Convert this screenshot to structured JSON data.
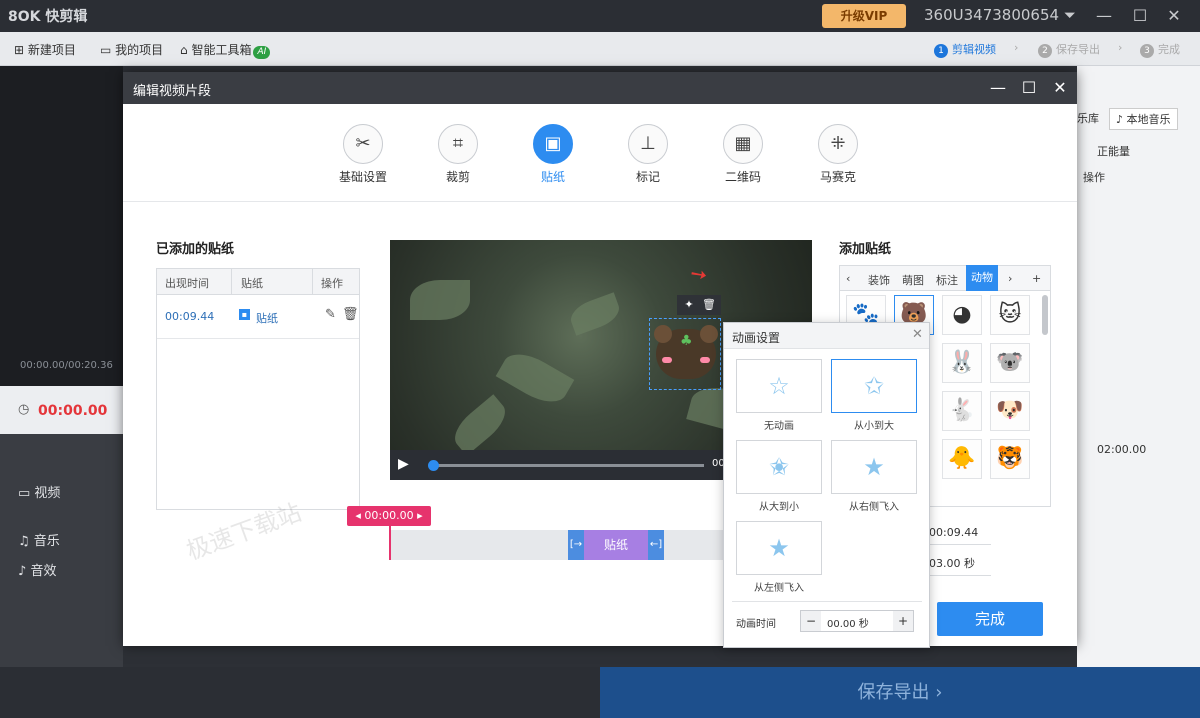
{
  "app": {
    "logo": "8OK 快剪辑",
    "vip": "升级VIP",
    "account": "360U3473800654 ⏷"
  },
  "toolbar": {
    "new_project": "新建项目",
    "my_projects": "我的项目",
    "smart_tools": "智能工具箱",
    "ai_badge": "AI",
    "steps": [
      {
        "num": "1",
        "label": "剪辑视频"
      },
      {
        "num": "2",
        "label": "保存导出"
      },
      {
        "num": "3",
        "label": "完成"
      }
    ]
  },
  "background": {
    "timecode": "00:00.00/00:20.36",
    "time": "00:00.00",
    "tracks": [
      "视频",
      "音乐",
      "音效"
    ],
    "right_music_lib": "乐库",
    "right_local_music": "本地音乐",
    "right_smart": "正能量",
    "right_ops": "操作",
    "right_time": "02:00.00",
    "export": "保存导出"
  },
  "dialog": {
    "title": "编辑视频片段",
    "tabs": [
      {
        "label": "基础设置",
        "icon": "scissors-icon"
      },
      {
        "label": "裁剪",
        "icon": "crop-icon"
      },
      {
        "label": "贴纸",
        "icon": "image-icon"
      },
      {
        "label": "标记",
        "icon": "pin-icon"
      },
      {
        "label": "二维码",
        "icon": "qrcode-icon"
      },
      {
        "label": "马赛克",
        "icon": "mosaic-icon"
      }
    ],
    "added_title": "已添加的贴纸",
    "table": {
      "headers": [
        "出现时间",
        "贴纸",
        "操作"
      ],
      "rows": [
        {
          "time": "00:09.44",
          "name": "贴纸"
        }
      ]
    },
    "video": {
      "time_short": "00"
    },
    "timeline": {
      "marker": "00:00.00",
      "clip": "贴纸"
    },
    "watermark": "极速下载站",
    "sticker_panel": {
      "title": "添加贴纸",
      "tabs": [
        "装饰",
        "萌图",
        "标注",
        "动物"
      ],
      "active_tab": "动物"
    },
    "fields": {
      "appear": "00:09.44",
      "duration": "03.00 秒"
    },
    "done": "完成"
  },
  "anim_popup": {
    "title": "动画设置",
    "options": [
      "无动画",
      "从小到大",
      "从大到小",
      "从右侧飞入",
      "从左侧飞入"
    ],
    "selected": "从小到大",
    "duration_label": "动画时间",
    "duration_value": "00.00 秒"
  }
}
